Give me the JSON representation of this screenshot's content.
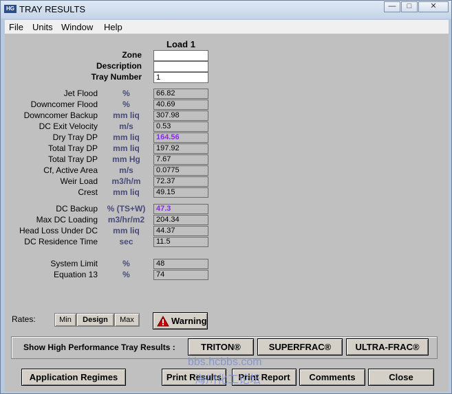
{
  "window": {
    "title": "TRAY RESULTS",
    "icon": "HG"
  },
  "menu": [
    "File",
    "Units",
    "Window",
    "Help"
  ],
  "column_header": "Load 1",
  "identity": [
    {
      "label": "Zone",
      "value": ""
    },
    {
      "label": "Description",
      "value": ""
    },
    {
      "label": "Tray Number",
      "value": "1"
    }
  ],
  "group1": [
    {
      "label": "Jet Flood",
      "unit": "%",
      "value": "66.82"
    },
    {
      "label": "Downcomer Flood",
      "unit": "%",
      "value": "40.69"
    },
    {
      "label": "Downcomer Backup",
      "unit": "mm liq",
      "value": "307.98"
    },
    {
      "label": "DC Exit Velocity",
      "unit": "m/s",
      "value": "0.53"
    },
    {
      "label": "Dry Tray DP",
      "unit": "mm liq",
      "value": "164.56",
      "highlight": true
    },
    {
      "label": "Total Tray DP",
      "unit": "mm liq",
      "value": "197.92"
    },
    {
      "label": "Total Tray DP",
      "unit": "mm Hg",
      "value": "7.67"
    },
    {
      "label": "Cf, Active Area",
      "unit": "m/s",
      "value": "0.0775"
    },
    {
      "label": "Weir Load",
      "unit": "m3/h/m",
      "value": "72.37"
    },
    {
      "label": "Crest",
      "unit": "mm liq",
      "value": "49.15"
    }
  ],
  "group2": [
    {
      "label": "DC Backup",
      "unit": "% (TS+W)",
      "value": "47.3",
      "highlight": true
    },
    {
      "label": "Max DC Loading",
      "unit": "m3/hr/m2",
      "value": "204.34"
    },
    {
      "label": "Head Loss Under DC",
      "unit": "mm liq",
      "value": "44.37"
    },
    {
      "label": "DC Residence Time",
      "unit": "sec",
      "value": "11.5"
    }
  ],
  "group3": [
    {
      "label": "System Limit",
      "unit": "%",
      "value": "48"
    },
    {
      "label": "Equation 13",
      "unit": "%",
      "value": "74"
    }
  ],
  "rates": {
    "label": "Rates:",
    "options": [
      "Min",
      "Design",
      "Max"
    ],
    "selected": "Design"
  },
  "warning_button": "Warning",
  "high_perf": {
    "label": "Show High Performance Tray Results :",
    "buttons": [
      "TRITON®",
      "SUPERFRAC®",
      "ULTRA-FRAC®"
    ]
  },
  "bottom_buttons": {
    "application_regimes": "Application Regimes",
    "print_results": "Print Results",
    "print_report": "Print Report",
    "comments": "Comments",
    "close": "Close"
  },
  "watermark": {
    "line1": "bbs.hcbbs.com",
    "line2": "海川化工论坛"
  },
  "colors": {
    "highlight_value": "#8a2be2",
    "unit_text": "#4a4a7a",
    "panel": "#c0c0c0",
    "warning_icon": "#cc0000"
  }
}
